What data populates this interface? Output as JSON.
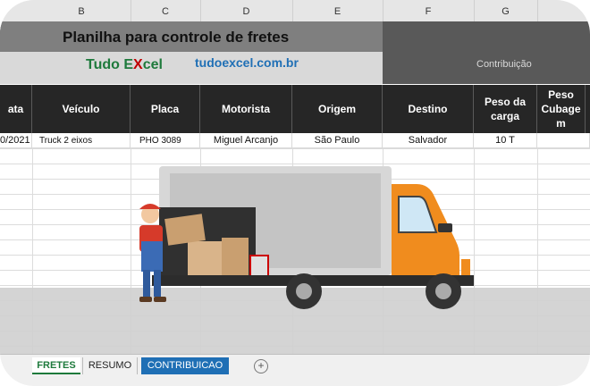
{
  "columns": [
    "B",
    "C",
    "D",
    "E",
    "F",
    "G"
  ],
  "title": "Planilha para controle de fretes",
  "brand": {
    "name_part1": "Tudo E",
    "name_x": "X",
    "name_part2": "cel",
    "url": "tudoexcel.com.br"
  },
  "contribution_label": "Contribuição",
  "table": {
    "headers": [
      "ata",
      "Veículo",
      "Placa",
      "Motorista",
      "Origem",
      "Destino",
      "Peso da carga",
      "Peso Cubage m"
    ],
    "row": [
      "0/2021",
      "Truck 2 eixos",
      "PHO 3089",
      "Miguel Arcanjo",
      "São Paulo",
      "Salvador",
      "10 T",
      ""
    ]
  },
  "tabs": [
    "FRETES",
    "RESUMO",
    "CONTRIBUICAO"
  ],
  "add_tab_symbol": "+",
  "colors": {
    "header_dark": "#262626",
    "title_band": "#7f7f7f",
    "accent_green": "#1e7a3c",
    "accent_blue": "#1f6fb5",
    "truck_orange": "#f08c1e"
  },
  "illustration": {
    "icon": "delivery-truck-illustration"
  }
}
